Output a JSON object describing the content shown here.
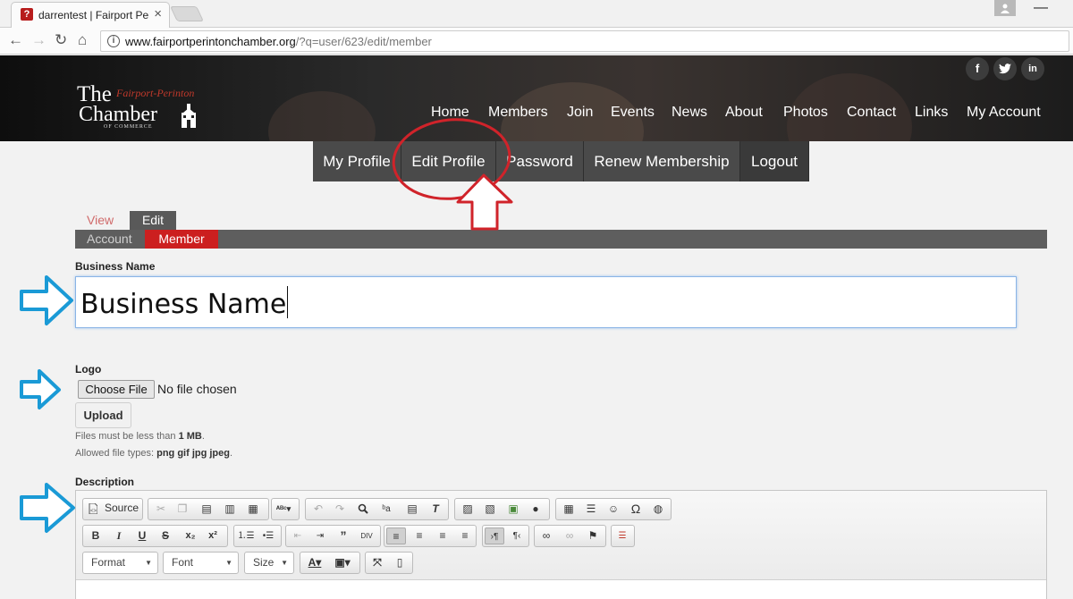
{
  "browser": {
    "tab_title": "darrentest | Fairport Perinton",
    "tab_close": "×",
    "favicon": "?",
    "url_host": "www.fairportperintonchamber.org",
    "url_path": "/?q=user/623/edit/member",
    "back": "←",
    "forward": "→",
    "reload": "↻",
    "home": "⌂",
    "info": "i",
    "minimize": "—"
  },
  "header": {
    "social": [
      "f",
      "t",
      "in"
    ],
    "logo": {
      "the": "The",
      "script": "Fairport-Perinton",
      "chamber": "Chamber",
      "commerce": "OF COMMERCE"
    },
    "nav": [
      "Home",
      "Members",
      "Join",
      "Events",
      "News",
      "About",
      "Photos",
      "Contact",
      "Links",
      "My Account"
    ]
  },
  "subnav": [
    "My Profile",
    "Edit Profile",
    "Password",
    "Renew Membership",
    "Logout"
  ],
  "tabs": {
    "view": "View",
    "edit": "Edit",
    "account": "Account",
    "member": "Member"
  },
  "form": {
    "business_name_label": "Business Name",
    "business_name_value": "Business Name",
    "logo_label": "Logo",
    "choose_file": "Choose File",
    "no_file": "No file chosen",
    "upload": "Upload",
    "help_size_prefix": "Files must be less than ",
    "help_size_value": "1 MB",
    "help_size_suffix": ".",
    "help_types_prefix": "Allowed file types: ",
    "help_types_value": "png gif jpg jpeg",
    "help_types_suffix": ".",
    "description_label": "Description"
  },
  "editor": {
    "source": "Source",
    "format": "Format",
    "font": "Font",
    "size": "Size"
  },
  "colors": {
    "accent_red": "#cc1f1f",
    "annotation_red": "#d0232a",
    "annotation_blue": "#1a9ad6"
  }
}
